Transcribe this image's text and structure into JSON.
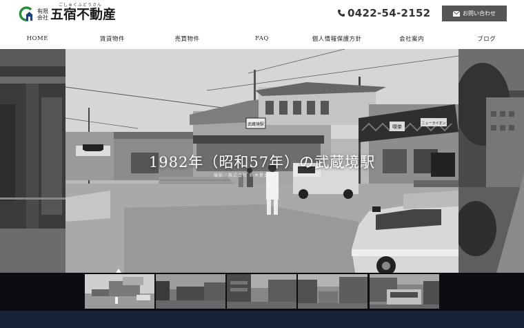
{
  "header": {
    "logo": {
      "small_line1": "有限",
      "small_line2": "会社",
      "name": "五宿不動産",
      "ruby": "ごしゅくふどうさん"
    },
    "phone": "0422-54-2152",
    "contact_label": "お問い合わせ"
  },
  "nav": {
    "items": [
      {
        "label": "HOME"
      },
      {
        "label": "賃貸物件"
      },
      {
        "label": "売買物件"
      },
      {
        "label": "FAQ"
      },
      {
        "label": "個人情報保護方針"
      },
      {
        "label": "会社案内"
      },
      {
        "label": "ブログ"
      }
    ]
  },
  "hero": {
    "caption": "1982年（昭和57年）の武蔵境駅",
    "sign_1": "武蔵境駅",
    "sign_2": "喫茶",
    "sign_3": "ニューライオン",
    "credit": "撮影／株式会社 鈴木貫太"
  },
  "thumbnails": {
    "count": 5,
    "active_index": 0
  },
  "colors": {
    "accent_green": "#2a8a3e",
    "button_gray": "#555555",
    "thumb_strip": "#0b0d12",
    "bottom_band": "#172336"
  }
}
